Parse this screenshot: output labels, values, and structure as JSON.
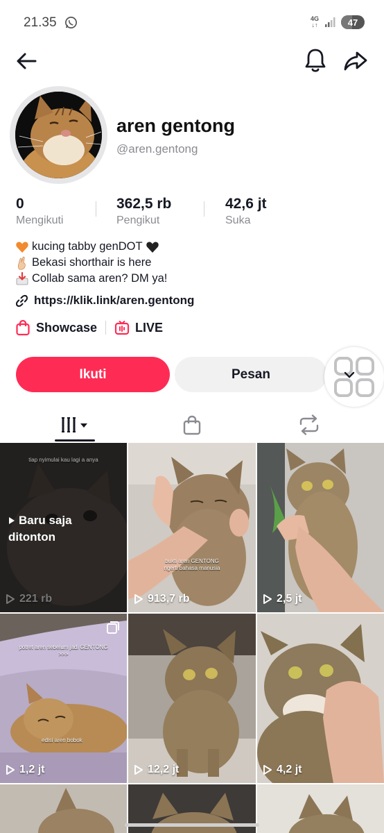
{
  "status_bar": {
    "time": "21.35",
    "network_top": "4G",
    "network_bottom": "↓↑",
    "battery": "47",
    "battery_level": 0.47
  },
  "profile": {
    "display_name": "aren gentong",
    "username": "@aren.gentong"
  },
  "stats": [
    {
      "value": "0",
      "label": "Mengikuti"
    },
    {
      "value": "362,5 rb",
      "label": "Pengikut"
    },
    {
      "value": "42,6 jt",
      "label": "Suka"
    }
  ],
  "bio": {
    "line1": "kucing tabby genDOT",
    "line2": "Bekasi shorthair is here",
    "line3": "Collab sama aren? DM ya!"
  },
  "link": "https://klik.link/aren.gentong",
  "features": {
    "showcase": "Showcase",
    "live": "LIVE"
  },
  "buttons": {
    "follow": "Ikuti",
    "message": "Pesan"
  },
  "colors": {
    "accent": "#fe2c55",
    "text": "#161823",
    "secondary": "#8a8b91"
  },
  "videos": [
    {
      "views": "221 rb",
      "overlay": "Baru saja ditonton",
      "overlay_line1": "Baru saja",
      "overlay_line2": "ditonton",
      "caption": "tiap nyimulai kau lagi a anya"
    },
    {
      "views": "913,7 rb",
      "caption_line1": "bukti aren GENTONG",
      "caption_line2": "ngerti bahasa manusia"
    },
    {
      "views": "2,5 jt"
    },
    {
      "views": "1,2 jt",
      "caption_line1": "potret aren sebelum jadi GENTONG",
      "caption_line2": ">>>",
      "caption_bottom": "edisi aren bobok"
    },
    {
      "views": "12,2 jt"
    },
    {
      "views": "4,2 jt"
    }
  ]
}
